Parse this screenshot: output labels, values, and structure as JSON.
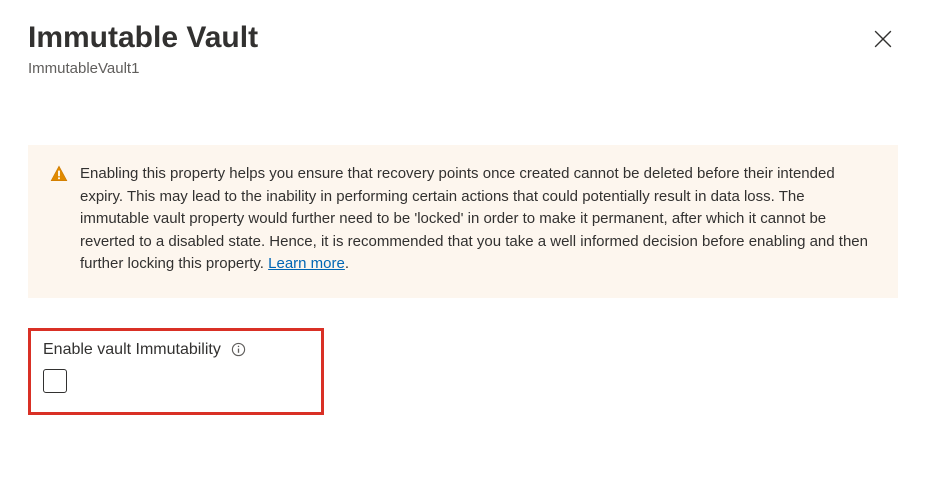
{
  "header": {
    "title": "Immutable Vault",
    "subtitle": "ImmutableVault1"
  },
  "warning": {
    "text": "Enabling this property helps you ensure that recovery points once created cannot be deleted before their intended expiry. This may lead to the inability in performing certain actions that could potentially result in data loss. The immutable vault property would further need to be 'locked' in order to make it permanent, after which it cannot be reverted to a disabled state. Hence, it is recommended that you take a well informed decision before enabling and then further locking this property. ",
    "learnMoreLabel": "Learn more"
  },
  "option": {
    "label": "Enable vault Immutability",
    "checked": false
  }
}
